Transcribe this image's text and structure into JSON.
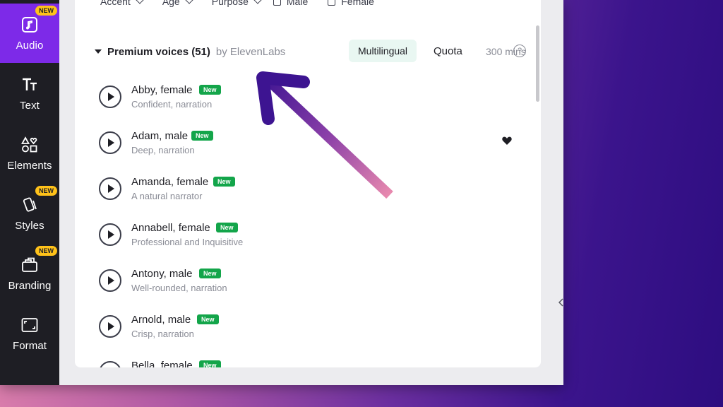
{
  "sidebar": {
    "items": [
      {
        "label": "Audio",
        "icon": "music-note-icon",
        "badge": "NEW",
        "active": true
      },
      {
        "label": "Text",
        "icon": "text-icon",
        "badge": null
      },
      {
        "label": "Elements",
        "icon": "shapes-icon",
        "badge": null
      },
      {
        "label": "Styles",
        "icon": "styles-icon",
        "badge": "NEW"
      },
      {
        "label": "Branding",
        "icon": "branding-icon",
        "badge": "NEW"
      },
      {
        "label": "Format",
        "icon": "format-icon",
        "badge": null
      }
    ]
  },
  "filters": {
    "accent": "Accent",
    "age": "Age",
    "purpose": "Purpose",
    "male": "Male",
    "female": "Female"
  },
  "section": {
    "title": "Premium voices (51)",
    "by": "by ElevenLabs",
    "multilingual": "Multilingual",
    "quota_label": "Quota",
    "quota_value": "300 mins",
    "help": "?"
  },
  "voices": [
    {
      "name": "Abby, female",
      "desc": "Confident, narration",
      "badge": "New"
    },
    {
      "name": "Adam, male",
      "desc": "Deep, narration",
      "badge": "New"
    },
    {
      "name": "Amanda, female",
      "desc": "A natural narrator",
      "badge": "New"
    },
    {
      "name": "Annabell, female",
      "desc": "Professional and Inquisitive",
      "badge": "New"
    },
    {
      "name": "Antony, male",
      "desc": "Well-rounded, narration",
      "badge": "New"
    },
    {
      "name": "Arnold, male",
      "desc": "Crisp, narration",
      "badge": "New"
    },
    {
      "name": "Bella, female",
      "desc": "",
      "badge": "New"
    }
  ],
  "colors": {
    "sidebar_bg": "#1e1e24",
    "active": "#7d2ae8",
    "new_badge": "#ffc21a",
    "voice_new": "#13a54a",
    "arrow_start": "#3d1491",
    "arrow_end": "#e98aae"
  }
}
